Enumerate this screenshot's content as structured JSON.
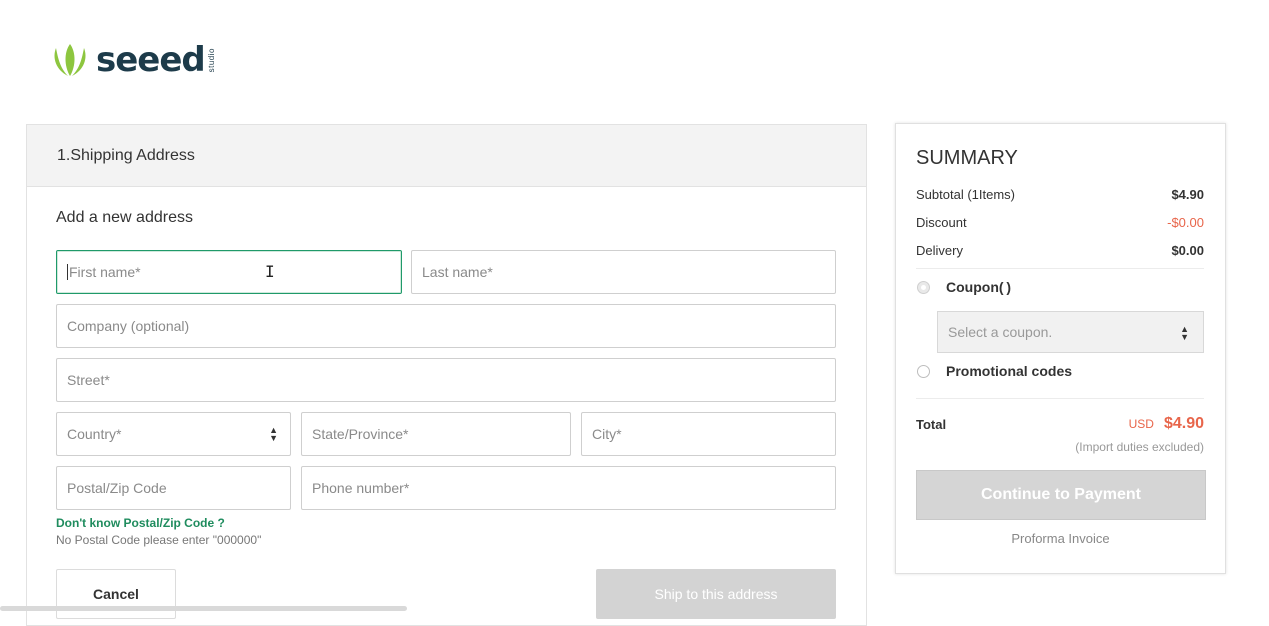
{
  "logo": {
    "word": "seeed",
    "sub": "studio"
  },
  "shipping": {
    "section_title": "1.Shipping Address",
    "subtitle": "Add a new address",
    "fields": {
      "first_name": "First name*",
      "last_name": "Last name*",
      "company": "Company (optional)",
      "street": "Street*",
      "country": "Country*",
      "state": "State/Province*",
      "city": "City*",
      "postal": "Postal/Zip Code",
      "phone": "Phone number*"
    },
    "zip_help_link": "Don't know Postal/Zip Code ?",
    "zip_note": "No Postal Code please enter \"000000\"",
    "cancel_label": "Cancel",
    "ship_label": "Ship to this address"
  },
  "summary": {
    "title": "SUMMARY",
    "subtotal_label": "Subtotal (1Items)",
    "subtotal_value": "$4.90",
    "discount_label": "Discount",
    "discount_value": "-$0.00",
    "delivery_label": "Delivery",
    "delivery_value": "$0.00",
    "coupon_label": "Coupon(",
    "coupon_label_end": ")",
    "coupon_placeholder": "Select a coupon.",
    "promo_label": "Promotional codes",
    "total_label": "Total",
    "total_currency": "USD",
    "total_value": "$4.90",
    "duties_note": "(Import duties excluded)",
    "pay_label": "Continue to Payment",
    "proforma_label": "Proforma Invoice"
  },
  "colors": {
    "accent_green": "#1f9a6a",
    "price_red": "#e8654a",
    "logo_green": "#8dc63f",
    "logo_navy": "#1d3b4a"
  },
  "icons": [
    "logo-leaf-icon",
    "select-arrows-icon",
    "text-cursor-icon",
    "radio-icon"
  ]
}
